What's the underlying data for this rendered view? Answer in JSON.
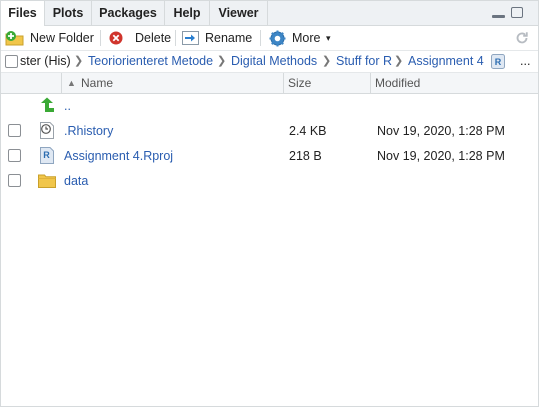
{
  "tabs": [
    "Files",
    "Plots",
    "Packages",
    "Help",
    "Viewer"
  ],
  "toolbar": {
    "new_folder": "New Folder",
    "delete": "Delete",
    "rename": "Rename",
    "more": "More",
    "more_caret": "▾",
    "refresh_icon": "refresh-icon"
  },
  "breadcrumb": {
    "items": [
      "ster (His)",
      "Teoriorienteret Metode",
      "Digital Methods",
      "Stuff for R",
      "Assignment 4"
    ],
    "separator": "❯",
    "overflow": "..."
  },
  "columns": {
    "name": "Name",
    "size": "Size",
    "modified": "Modified",
    "sort_indicator": "▲"
  },
  "files": [
    {
      "name": "..",
      "size": "",
      "modified": "",
      "icon": "up-arrow-icon"
    },
    {
      "name": ".Rhistory",
      "size": "2.4 KB",
      "modified": "Nov 19, 2020, 1:28 PM",
      "icon": "rhistory-icon"
    },
    {
      "name": "Assignment 4.Rproj",
      "size": "218 B",
      "modified": "Nov 19, 2020, 1:28 PM",
      "icon": "rproj-icon"
    },
    {
      "name": "data",
      "size": "",
      "modified": "",
      "icon": "folder-icon"
    }
  ],
  "colors": {
    "link": "#2a5db0",
    "accent_green": "#3aa935",
    "folder": "#f1c64a"
  }
}
